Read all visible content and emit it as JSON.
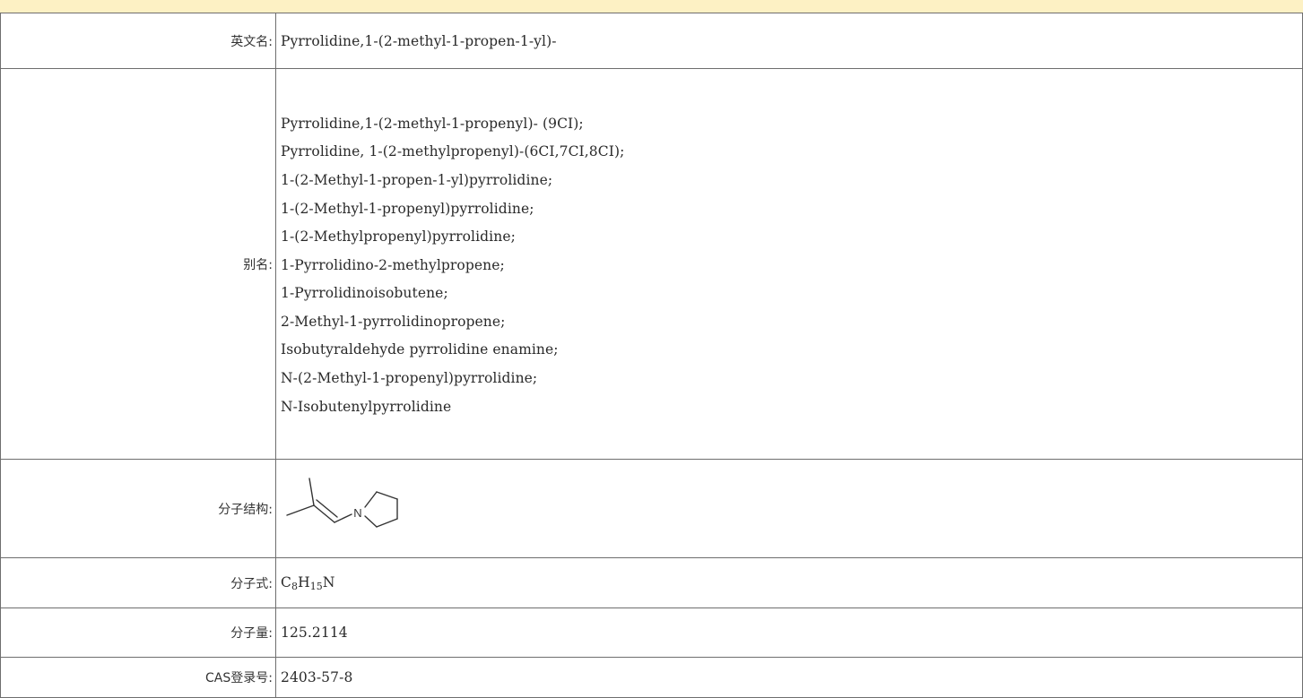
{
  "rows": {
    "english_name": {
      "label": "英文名:",
      "value": "Pyrrolidine,1-(2-methyl-1-propen-1-yl)-"
    },
    "aliases": {
      "label": "别名:",
      "items": [
        "Pyrrolidine,1-(2-methyl-1-propenyl)- (9CI);",
        "Pyrrolidine, 1-(2-methylpropenyl)-(6CI,7CI,8CI);",
        "1-(2-Methyl-1-propen-1-yl)pyrrolidine;",
        "1-(2-Methyl-1-propenyl)pyrrolidine;",
        "1-(2-Methylpropenyl)pyrrolidine;",
        "1-Pyrrolidino-2-methylpropene;",
        "1-Pyrrolidinoisobutene;",
        "2-Methyl-1-pyrrolidinopropene;",
        "Isobutyraldehyde pyrrolidine enamine;",
        "N-(2-Methyl-1-propenyl)pyrrolidine;",
        "N-Isobutenylpyrrolidine"
      ]
    },
    "structure": {
      "label": "分子结构:",
      "atom_label": "N"
    },
    "formula": {
      "label": "分子式:",
      "c": "C",
      "c_count": "8",
      "h": "H",
      "h_count": "15",
      "n": "N"
    },
    "weight": {
      "label": "分子量:",
      "value": "125.2114"
    },
    "cas": {
      "label": "CAS登录号:",
      "value": "2403-57-8"
    }
  }
}
